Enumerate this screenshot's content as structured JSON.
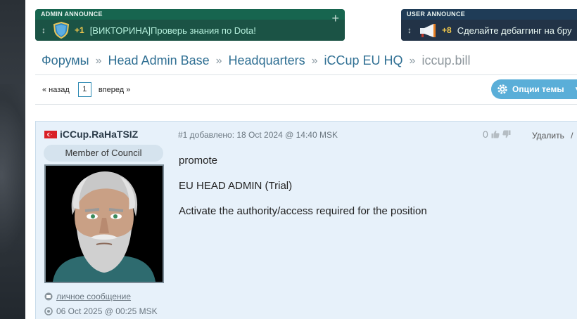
{
  "announcements": {
    "admin": {
      "heading": "ADMIN ANNOUNCE",
      "count": "+1",
      "text": "[ВИКТОРИНА]Проверь знания по Dota!",
      "icon": "shield-icon"
    },
    "user": {
      "heading": "USER ANNOUNCE",
      "count": "+8",
      "text": "Сделайте дебаггинг на бру",
      "icon": "megaphone-icon"
    }
  },
  "breadcrumb": {
    "items": [
      "Форумы",
      "Head Admin Base",
      "Headquarters",
      "iCCup EU HQ"
    ],
    "current": "iccup.bill",
    "separator": "»"
  },
  "pager": {
    "prev": "« назад",
    "page": "1",
    "next": "вперед »"
  },
  "options_button": {
    "label": "Опции темы"
  },
  "post": {
    "author": "iCCup.RaHaTSIZ",
    "rank": "Member of Council",
    "pm_label": "личное сообщение",
    "last_seen": "06 Oct 2025 @ 00:25 MSK",
    "meta": "#1 добавлено: 18 Oct 2024 @ 14:40 MSK",
    "rating": "0",
    "delete_label": "Удалить",
    "delete_sep": "/",
    "body": [
      "promote",
      "EU HEAD ADMIN (Trial)",
      "Activate the authority/access required for the position"
    ]
  },
  "colors": {
    "admin_announce_bg": "#17654f",
    "user_announce_bg": "#1f3c57",
    "link": "#2f6f93",
    "accent_button": "#5aaed8",
    "post_bg": "#e7f1fa"
  }
}
